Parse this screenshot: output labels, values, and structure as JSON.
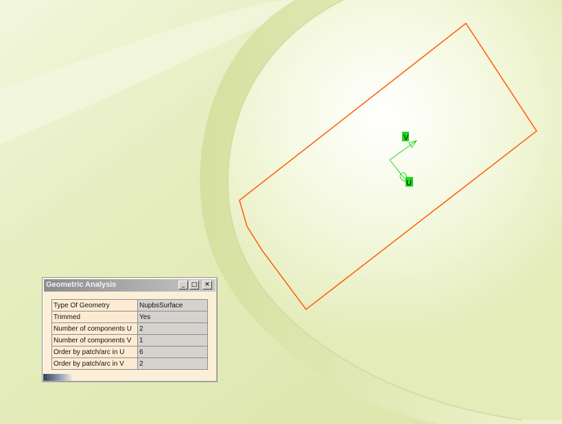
{
  "dialog": {
    "title": "Geometric Analysis",
    "minimize_glyph": "_",
    "maximize_glyph": "□",
    "close_glyph": "✕",
    "rows": [
      {
        "label": "Type Of Geometry",
        "value": "NupbsSurface"
      },
      {
        "label": "Trimmed",
        "value": "Yes"
      },
      {
        "label": "Number of components U",
        "value": "2"
      },
      {
        "label": "Number of components V",
        "value": "1"
      },
      {
        "label": "Order by patch/arc in U",
        "value": "6"
      },
      {
        "label": "Order by patch/arc in V",
        "value": "2"
      }
    ]
  },
  "viewport": {
    "axis_v_label": "V",
    "axis_u_label": "U",
    "boundary_color": "#ff5a00",
    "axis_color": "#1ed51e"
  }
}
